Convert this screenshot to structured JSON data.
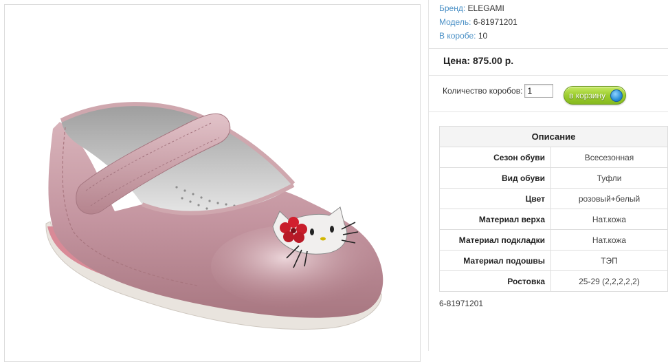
{
  "product_image": {
    "alt": "",
    "icons": [
      "flower-icon",
      "cat-face-icon"
    ]
  },
  "info": {
    "brand_label": "Бренд:",
    "brand_value": "ELEGAMI",
    "model_label": "Модель:",
    "model_value": "6-81971201",
    "box_label": "В коробе:",
    "box_value": "10"
  },
  "price": {
    "text": "Цена: 875.00 р."
  },
  "order": {
    "qty_label": "Количество коробов:",
    "qty_value": "1",
    "cart_button_label": "в корзину",
    "cart_icon": "basket-icon"
  },
  "description": {
    "title": "Описание",
    "rows": [
      {
        "name": "Сезон обуви",
        "value": "Всесезонная"
      },
      {
        "name": "Вид обуви",
        "value": "Туфли"
      },
      {
        "name": "Цвет",
        "value": "розовый+белый"
      },
      {
        "name": "Материал верха",
        "value": "Нат.кожа"
      },
      {
        "name": "Материал подкладки",
        "value": "Нат.кожа"
      },
      {
        "name": "Материал подошвы",
        "value": "ТЭП"
      },
      {
        "name": "Ростовка",
        "value": "25-29 (2,2,2,2,2)"
      }
    ]
  },
  "footer": {
    "model_code": "6-81971201"
  },
  "colors": {
    "label_link": "#4a90c6",
    "button_green": "#9ccd2f",
    "shoe_pink": "#c99aa3"
  }
}
